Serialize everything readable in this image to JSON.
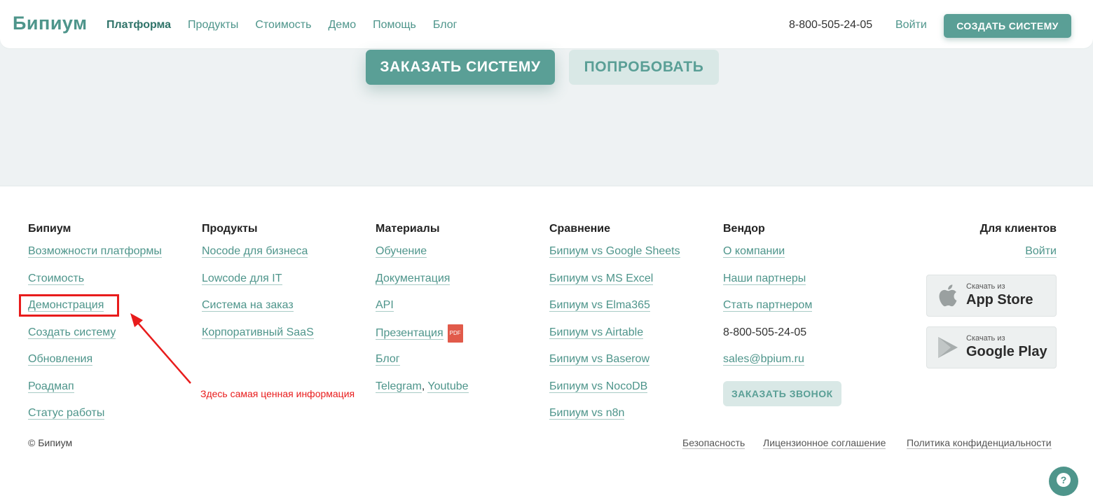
{
  "header": {
    "logo": "Бипиум",
    "nav": [
      "Платформа",
      "Продукты",
      "Стоимость",
      "Демо",
      "Помощь",
      "Блог"
    ],
    "phone": "8-800-505-24-05",
    "login": "Войти",
    "create_button": "СОЗДАТЬ СИСТЕМУ"
  },
  "hero": {
    "order_button": "ЗАКАЗАТЬ СИСТЕМУ",
    "try_button": "ПОПРОБОВАТЬ"
  },
  "footer": {
    "bipium": {
      "title": "Бипиум",
      "links": [
        "Возможности платформы",
        "Стоимость",
        "Демонстрация",
        "Создать систему",
        "Обновления",
        "Роадмап",
        "Статус работы"
      ]
    },
    "products": {
      "title": "Продукты",
      "links": [
        "Nocode для бизнеса",
        "Lowcode для IT",
        "Система на заказ",
        "Корпоративный SaaS"
      ]
    },
    "materials": {
      "title": "Материалы",
      "links": [
        "Обучение",
        "Документация",
        "API",
        "Презентация",
        "Блог"
      ],
      "pdf_badge": "PDF",
      "telegram": "Telegram",
      "youtube": "Youtube"
    },
    "comparison": {
      "title": "Сравнение",
      "links": [
        "Бипиум vs Google Sheets",
        "Бипиум vs MS Excel",
        "Бипиум vs Elma365",
        "Бипиум vs Airtable",
        "Бипиум vs Baserow",
        "Бипиум vs NocoDB",
        "Бипиум vs n8n"
      ]
    },
    "vendor": {
      "title": "Вендор",
      "links": [
        "О компании",
        "Наши партнеры",
        "Стать партнером"
      ],
      "phone": "8-800-505-24-05",
      "email": "sales@bpium.ru",
      "callback_button": "ЗАКАЗАТЬ ЗВОНОК"
    },
    "clients": {
      "title": "Для клиентов",
      "login": "Войти",
      "appstore_small": "Скачать из",
      "appstore_big": "App Store",
      "googleplay_small": "Скачать из",
      "googleplay_big": "Google Play"
    },
    "copyright": "© Бипиум",
    "legal": [
      "Безопасность",
      "Лицензионное соглашение",
      "Политика конфиденциальности"
    ]
  },
  "annotation": {
    "text": "Здесь самая ценная информация",
    "color": "#e81c1c"
  },
  "colors": {
    "accent": "#5a9f96",
    "link": "#4e958b",
    "light_button": "#d9e8e6"
  }
}
